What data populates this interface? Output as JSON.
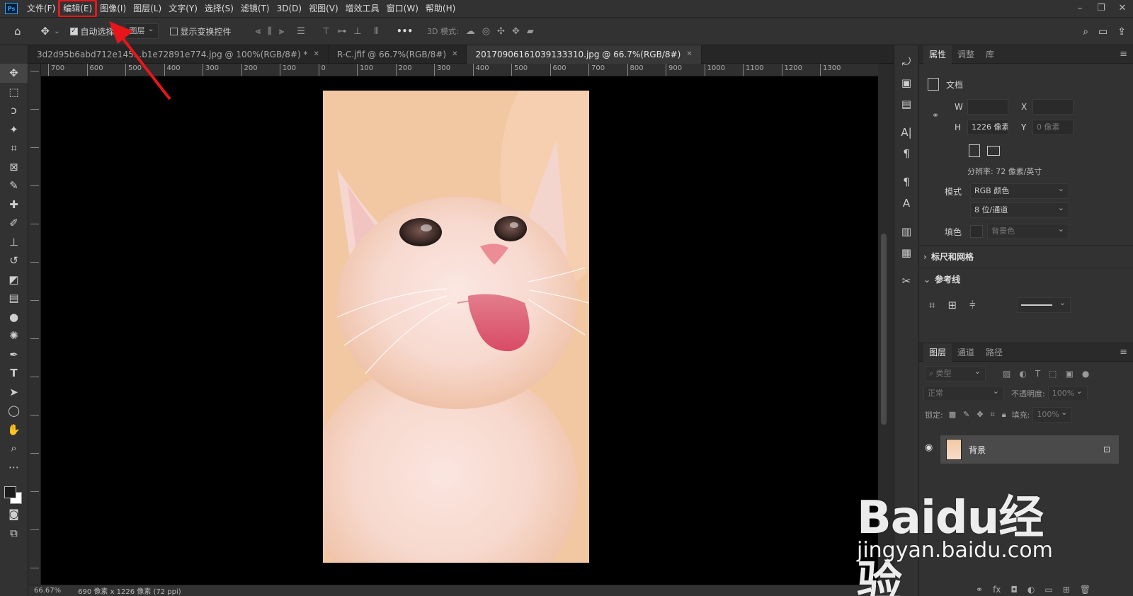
{
  "app": {
    "logo": "Ps"
  },
  "menu": [
    "文件(F)",
    "编辑(E)",
    "图像(I)",
    "图层(L)",
    "文字(Y)",
    "选择(S)",
    "滤镜(T)",
    "3D(D)",
    "视图(V)",
    "增效工具",
    "窗口(W)",
    "帮助(H)"
  ],
  "options": {
    "auto_select_label": "自动选择:",
    "auto_select_target": "图层",
    "show_transform_label": "显示变换控件",
    "mode_3d_label": "3D 模式:",
    "more": "•••"
  },
  "tabs": [
    {
      "label": "3d2d95b6abd712e145...b1e72891e774.jpg @ 100%(RGB/8#) *"
    },
    {
      "label": "R-C.jfif @ 66.7%(RGB/8#)"
    },
    {
      "label": "20170906161039133310.jpg @ 66.7%(RGB/8#)"
    }
  ],
  "ruler_top": [
    "700",
    "600",
    "500",
    "400",
    "300",
    "200",
    "100",
    "0",
    "100",
    "200",
    "300",
    "400",
    "500",
    "600",
    "700",
    "800",
    "900",
    "1000",
    "1100",
    "1200",
    "1300"
  ],
  "properties_panel": {
    "tabs": [
      "属性",
      "调整",
      "库"
    ],
    "doc_label": "文档",
    "w_label": "W",
    "w_value": "",
    "x_label": "X",
    "x_value": "",
    "h_label": "H",
    "h_value": "1226 像素",
    "y_label": "Y",
    "y_value": "0 像素",
    "resolution": "分辨率: 72 像素/英寸",
    "mode_label": "模式",
    "mode_value": "RGB 颜色",
    "depth_value": "8 位/通道",
    "fill_label": "填色",
    "fill_value": "背景色",
    "section_rulers": "标尺和网格",
    "section_guides": "参考线"
  },
  "layers_panel": {
    "tabs": [
      "图层",
      "通道",
      "路径"
    ],
    "kind_label": "类型",
    "blend_mode": "正常",
    "opacity_label": "不透明度:",
    "opacity_value": "100%",
    "lock_label": "锁定:",
    "fill_label": "填充:",
    "fill_value": "100%",
    "layers": [
      {
        "name": "背景",
        "locked": true,
        "visible": true
      }
    ]
  },
  "status": {
    "zoom": "66.67%",
    "doc_info": "690 像素 x 1226 像素 (72 ppi)"
  },
  "watermark": {
    "brand": "Baidu经验",
    "url": "jingyan.baidu.com"
  },
  "colors": {
    "highlight": "#e8161b",
    "arrow": "#e8161b"
  }
}
